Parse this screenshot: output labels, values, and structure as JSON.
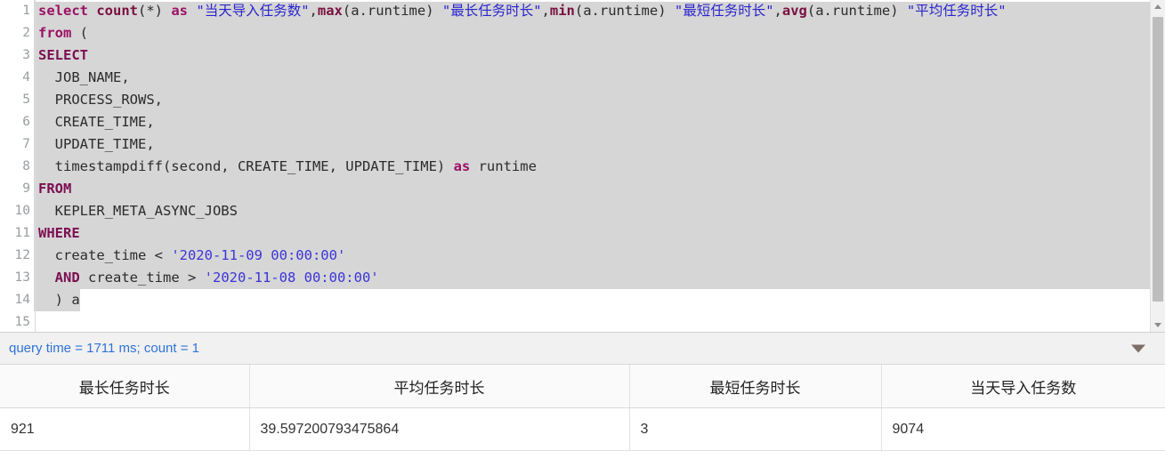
{
  "editor": {
    "language": "sql",
    "lines": [
      {
        "number": "1",
        "selected": true,
        "tokens": [
          {
            "t": "select",
            "c": "kw"
          },
          {
            "t": " ",
            "c": "pl"
          },
          {
            "t": "count",
            "c": "fn"
          },
          {
            "t": "(*) ",
            "c": "pl"
          },
          {
            "t": "as",
            "c": "kw"
          },
          {
            "t": " ",
            "c": "pl"
          },
          {
            "t": "\"当天导入任务数\"",
            "c": "str"
          },
          {
            "t": ",",
            "c": "pl"
          },
          {
            "t": "max",
            "c": "fn"
          },
          {
            "t": "(a.runtime) ",
            "c": "pl"
          },
          {
            "t": "\"最长任务时长\"",
            "c": "str"
          },
          {
            "t": ",",
            "c": "pl"
          },
          {
            "t": "min",
            "c": "fn"
          },
          {
            "t": "(a.runtime) ",
            "c": "pl"
          },
          {
            "t": "\"最短任务时长\"",
            "c": "str"
          },
          {
            "t": ",",
            "c": "pl"
          },
          {
            "t": "avg",
            "c": "fn"
          },
          {
            "t": "(a.runtime) ",
            "c": "pl"
          },
          {
            "t": "\"平均任务时长\"",
            "c": "str"
          }
        ]
      },
      {
        "number": "2",
        "selected": true,
        "tokens": [
          {
            "t": "from",
            "c": "kw"
          },
          {
            "t": " (",
            "c": "pl"
          }
        ]
      },
      {
        "number": "3",
        "selected": true,
        "tokens": [
          {
            "t": "SELECT",
            "c": "kw2"
          }
        ]
      },
      {
        "number": "4",
        "selected": true,
        "tokens": [
          {
            "t": "  JOB_NAME,",
            "c": "pl"
          }
        ]
      },
      {
        "number": "5",
        "selected": true,
        "tokens": [
          {
            "t": "  PROCESS_ROWS,",
            "c": "pl"
          }
        ]
      },
      {
        "number": "6",
        "selected": true,
        "tokens": [
          {
            "t": "  CREATE_TIME,",
            "c": "pl"
          }
        ]
      },
      {
        "number": "7",
        "selected": true,
        "tokens": [
          {
            "t": "  UPDATE_TIME,",
            "c": "pl"
          }
        ]
      },
      {
        "number": "8",
        "selected": true,
        "tokens": [
          {
            "t": "  timestampdiff(second, CREATE_TIME, UPDATE_TIME) ",
            "c": "pl"
          },
          {
            "t": "as",
            "c": "kw"
          },
          {
            "t": " runtime",
            "c": "pl"
          }
        ]
      },
      {
        "number": "9",
        "selected": true,
        "tokens": [
          {
            "t": "FROM",
            "c": "kw2"
          }
        ]
      },
      {
        "number": "10",
        "selected": true,
        "tokens": [
          {
            "t": "  KEPLER_META_ASYNC_JOBS",
            "c": "pl"
          }
        ]
      },
      {
        "number": "11",
        "selected": true,
        "tokens": [
          {
            "t": "WHERE",
            "c": "kw2"
          }
        ]
      },
      {
        "number": "12",
        "selected": true,
        "tokens": [
          {
            "t": "  create_time < ",
            "c": "pl"
          },
          {
            "t": "'2020-11-09 00:00:00'",
            "c": "str2"
          }
        ]
      },
      {
        "number": "13",
        "selected": true,
        "tokens": [
          {
            "t": "  ",
            "c": "pl"
          },
          {
            "t": "AND",
            "c": "kw2"
          },
          {
            "t": " create_time > ",
            "c": "pl"
          },
          {
            "t": "'2020-11-08 00:00:00'",
            "c": "str2"
          }
        ]
      },
      {
        "number": "14",
        "selected": true,
        "partial": true,
        "tokens": [
          {
            "t": "  ) a",
            "c": "pl"
          }
        ]
      },
      {
        "number": "15",
        "selected": false,
        "tokens": []
      }
    ],
    "scrollbar": {
      "up_arrow": "scroll-up-arrow",
      "down_arrow": "scroll-down-arrow"
    }
  },
  "statusbar": {
    "text": "query time = 1711 ms; count = 1",
    "query_time_ms": "1711",
    "row_count": "1",
    "caret": "collapse-caret"
  },
  "result_table": {
    "columns": [
      "最长任务时长",
      "平均任务时长",
      "最短任务时长",
      "当天导入任务数"
    ],
    "rows": [
      [
        "921",
        "39.597200793475864",
        "3",
        "9074"
      ]
    ]
  },
  "colors": {
    "keyword": "#9b1163",
    "string": "#2a25cc",
    "status_text": "#2f73d8",
    "selection": "#d6d6d6",
    "header_bg": "#fafafa"
  }
}
